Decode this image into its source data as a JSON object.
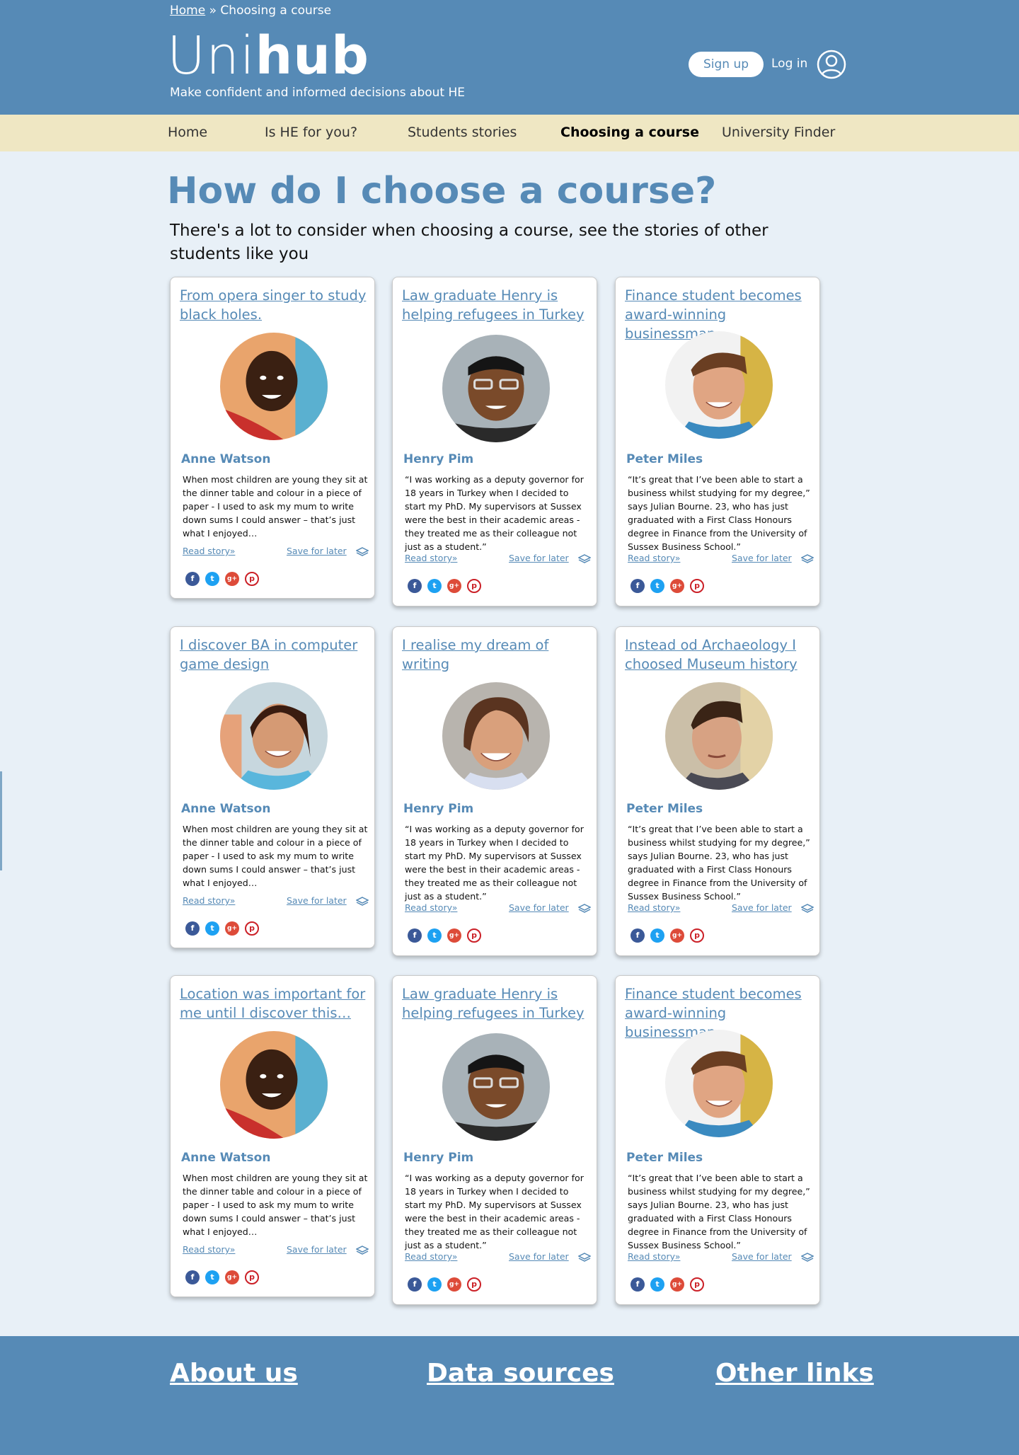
{
  "breadcrumb": {
    "home": "Home",
    "separator": "»",
    "current": "Choosing a course"
  },
  "brand": {
    "logo_light": "Uni",
    "logo_bold": "hub",
    "tagline": "Make confident and informed decisions about HE"
  },
  "auth": {
    "signup": "Sign up",
    "login": "Log in"
  },
  "nav": [
    {
      "label": "Home"
    },
    {
      "label": "Is HE for you?"
    },
    {
      "label": "Students stories"
    },
    {
      "label": "Choosing a course",
      "active": true
    },
    {
      "label": "University Finder"
    }
  ],
  "page": {
    "title": "How do I choose a course?",
    "intro": "There's a lot to consider when choosing a course, see the stories of other students like you"
  },
  "cards": [
    {
      "title": "From opera singer to study black holes.",
      "name": "Anne Watson",
      "text": "When most children are young they sit at the dinner table and colour in a piece of paper - I used to ask my mum to write down sums I could answer – that’s just what I enjoyed…",
      "read": "Read story»",
      "save": "Save for later"
    },
    {
      "title": "Law graduate Henry is helping refugees in Turkey",
      "name": "Henry Pim",
      "text": "“I was working as a deputy governor for 18 years in Turkey when I decided to start my PhD. My supervisors at Sussex were the best in their academic areas - they treated me as their colleague not just as a student.”",
      "read": "Read story»",
      "save": "Save for later"
    },
    {
      "title": "Finance student becomes award-winning businessman",
      "name": "Peter Miles",
      "text": "“It’s great that I’ve been able to start a business whilst studying for my degree,” says Julian Bourne. 23, who has just graduated with a First Class Honours degree in Finance from the University of Sussex Business School.”",
      "read": "Read story»",
      "save": "Save for later"
    },
    {
      "title": "I discover BA in computer game design",
      "name": "Anne Watson",
      "text": "When most children are young they sit at the dinner table and colour in a piece of paper - I used to ask my mum to write down sums I could answer – that’s just what I enjoyed…",
      "read": "Read story»",
      "save": "Save for later"
    },
    {
      "title": "I realise my dream of writing",
      "name": "Henry Pim",
      "text": "“I was working as a deputy governor for 18 years in Turkey when I decided to start my PhD. My supervisors at Sussex were the best in their academic areas - they treated me as their colleague not just as a student.”",
      "read": "Read story»",
      "save": "Save for later"
    },
    {
      "title": "Instead od Archaeology I choosed Museum history",
      "name": "Peter Miles",
      "text": "“It’s great that I’ve been able to start a business whilst studying for my degree,” says Julian Bourne. 23, who has just graduated with a First Class Honours degree in Finance from the University of Sussex Business School.”",
      "read": "Read story»",
      "save": "Save for later"
    },
    {
      "title": "Location was important for me until I discover this…",
      "name": "Anne Watson",
      "text": "When most children are young they sit at the dinner table and colour in a piece of paper - I used to ask my mum to write down sums I could answer – that’s just what I enjoyed…",
      "read": "Read story»",
      "save": "Save for later"
    },
    {
      "title": "Law graduate Henry is helping refugees in Turkey",
      "name": "Henry Pim",
      "text": "“I was working as a deputy governor for 18 years in Turkey when I decided to start my PhD. My supervisors at Sussex were the best in their academic areas - they treated me as their colleague not just as a student.”",
      "read": "Read story»",
      "save": "Save for later"
    },
    {
      "title": "Finance student becomes award-winning businessman",
      "name": "Peter Miles",
      "text": "“It’s great that I’ve been able to start a business whilst studying for my degree,” says Julian Bourne. 23, who has just graduated with a First Class Honours degree in Finance from the University of Sussex Business School.”",
      "read": "Read story»",
      "save": "Save for later"
    }
  ],
  "social_icons": [
    "facebook-icon",
    "twitter-icon",
    "google-plus-icon",
    "pinterest-icon"
  ],
  "social_glyphs": {
    "facebook": "f",
    "twitter": "t",
    "google": "g+",
    "pinterest": "p"
  },
  "footer": {
    "about": "About us",
    "data": "Data sources",
    "other": "Other links"
  },
  "colors": {
    "brand": "#568ab6",
    "nav_bg": "#efe7c3",
    "page_bg": "#e8f0f7"
  }
}
